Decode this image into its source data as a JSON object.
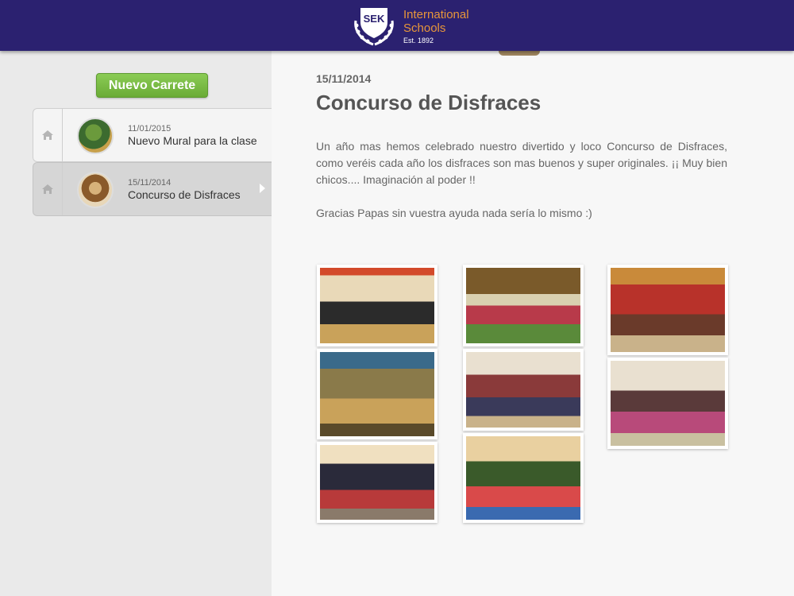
{
  "header": {
    "logo_name": "International",
    "logo_name2": "Schools",
    "logo_est": "Est. 1892",
    "crest_text": "SEK"
  },
  "sidebar": {
    "new_button": "Nuevo Carrete",
    "items": [
      {
        "date": "11/01/2015",
        "title": "Nuevo Mural para la clase",
        "icon": "home-icon"
      },
      {
        "date": "15/11/2014",
        "title": "Concurso de Disfraces",
        "icon": "home-icon",
        "selected": true
      }
    ]
  },
  "post": {
    "date": "15/11/2014",
    "title": "Concurso de Disfraces",
    "paragraph1": "Un año mas hemos celebrado nuestro divertido y loco Concurso de Disfraces, como veréis cada año los disfraces son mas buenos y super originales. ¡¡ Muy bien chicos.... Imaginación al poder !!",
    "paragraph2": "Gracias Papas sin vuestra ayuda nada sería lo mismo :)"
  },
  "colors": {
    "header_bg": "#2b2170",
    "logo_accent": "#e8963a",
    "button_green": "#7aba45"
  }
}
